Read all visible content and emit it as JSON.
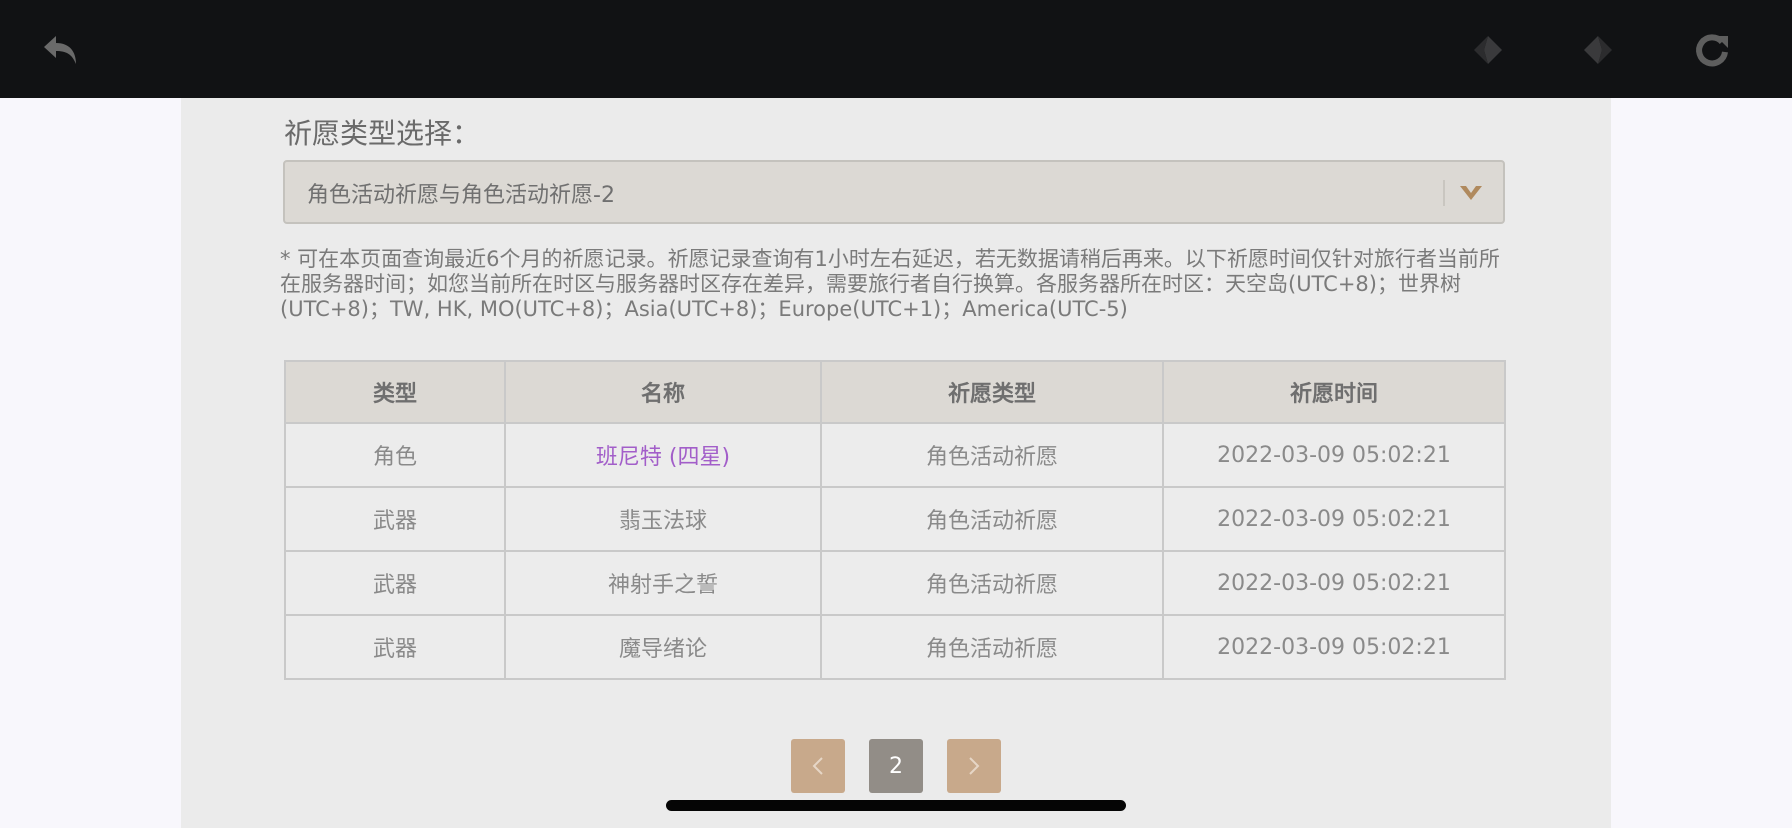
{
  "nav": {
    "back_icon": "undo-arrow-icon",
    "prev_icon": "previous-page-icon",
    "next_icon": "next-page-icon",
    "refresh_icon": "refresh-icon"
  },
  "filter": {
    "label": "祈愿类型选择：",
    "selected": "角色活动祈愿与角色活动祈愿-2"
  },
  "notice": "* 可在本页面查询最近6个月的祈愿记录。祈愿记录查询有1小时左右延迟，若无数据请稍后再来。以下祈愿时间仅针对旅行者当前所在服务器时间；如您当前所在时区与服务器时区存在差异，需要旅行者自行换算。各服务器所在时区：天空岛(UTC+8)；世界树(UTC+8)；TW, HK, MO(UTC+8)；Asia(UTC+8)；Europe(UTC+1)；America(UTC-5)",
  "table": {
    "headers": [
      "类型",
      "名称",
      "祈愿类型",
      "祈愿时间"
    ],
    "rows": [
      {
        "type": "角色",
        "name": "班尼特 (四星)",
        "wish_type": "角色活动祈愿",
        "time": "2022-03-09 05:02:21"
      },
      {
        "type": "武器",
        "name": "翡玉法球",
        "wish_type": "角色活动祈愿",
        "time": "2022-03-09 05:02:21"
      },
      {
        "type": "武器",
        "name": "神射手之誓",
        "wish_type": "角色活动祈愿",
        "time": "2022-03-09 05:02:21"
      },
      {
        "type": "武器",
        "name": "魔导绪论",
        "wish_type": "角色活动祈愿",
        "time": "2022-03-09 05:02:21"
      }
    ]
  },
  "pagination": {
    "current_page": "2",
    "prev_icon": "chevron-left-icon",
    "next_icon": "chevron-right-icon"
  },
  "colors": {
    "topbar": "#111214",
    "panel": "#ebebeb",
    "four_star_name": "#a25ec9",
    "pager_button": "#c8a98b",
    "pager_current": "#928d87"
  }
}
